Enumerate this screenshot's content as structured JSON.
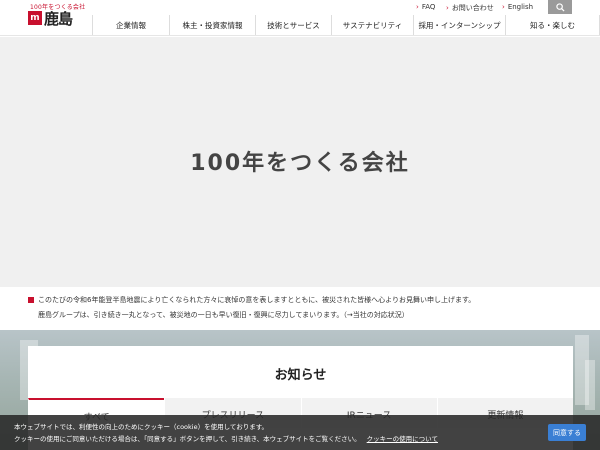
{
  "header": {
    "logo_tagline": "100年をつくる会社",
    "logo_mark": "m",
    "logo_name": "鹿島",
    "utility_links": [
      "FAQ",
      "お問い合わせ",
      "English"
    ],
    "nav": [
      "企業情報",
      "株主・投資家情報",
      "技術とサービス",
      "サステナビリティ",
      "採用・インターンシップ",
      "知る・楽しむ"
    ]
  },
  "hero": {
    "title": "100年をつくる会社"
  },
  "notice": {
    "line1": "このたびの令和6年能登半島地震により亡くなられた方々に哀悼の意を表しますとともに、被災された皆様へ心よりお見舞い申し上げます。",
    "line2": "鹿島グループは、引き続き一丸となって、被災地の一日も早い復旧・復興に尽力してまいります。（→当社の対応状況）"
  },
  "news": {
    "title": "お知らせ",
    "tabs": [
      "すべて",
      "プレスリリース",
      "IRニュース",
      "更新情報"
    ]
  },
  "cookie": {
    "line1": "本ウェブサイトでは、利便性の向上のためにクッキー（cookie）を使用しております。",
    "line2": "クッキーの使用にご同意いただける場合は、「同意する」ボタンを押して、引き続き、本ウェブサイトをご覧ください。",
    "link": "クッキーの使用について",
    "agree": "同意する"
  },
  "colors": {
    "brand": "#c8102e",
    "cookie_button": "#3a7fd4"
  }
}
